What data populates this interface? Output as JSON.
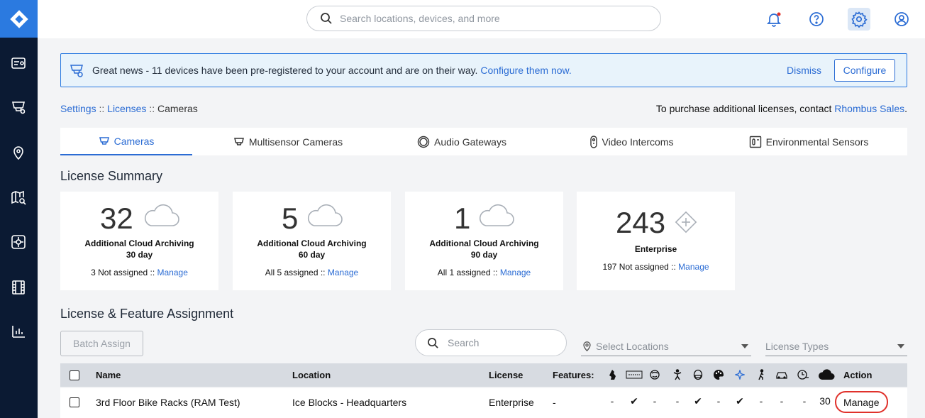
{
  "topbar": {
    "search_placeholder": "Search locations, devices, and more"
  },
  "banner": {
    "message": "Great news - 11 devices have been pre-registered to your account and are on their way. ",
    "link": "Configure them now.",
    "dismiss": "Dismiss",
    "configure": "Configure"
  },
  "breadcrumb": {
    "settings": "Settings",
    "sep1": " :: ",
    "licenses": "Licenses",
    "sep2": " :: ",
    "current": "Cameras"
  },
  "purchase": {
    "text": "To purchase additional licenses, contact ",
    "link": "Rhombus Sales",
    "end": "."
  },
  "tabs": [
    {
      "label": "Cameras"
    },
    {
      "label": "Multisensor Cameras"
    },
    {
      "label": "Audio Gateways"
    },
    {
      "label": "Video Intercoms"
    },
    {
      "label": "Environmental Sensors"
    }
  ],
  "summary": {
    "title": "License Summary",
    "cards": [
      {
        "count": "32",
        "line1": "Additional Cloud Archiving",
        "line2": "30 day",
        "status": "3 Not assigned :: ",
        "manage": "Manage"
      },
      {
        "count": "5",
        "line1": "Additional Cloud Archiving",
        "line2": "60 day",
        "status": "All 5 assigned :: ",
        "manage": "Manage"
      },
      {
        "count": "1",
        "line1": "Additional Cloud Archiving",
        "line2": "90 day",
        "status": "All 1 assigned :: ",
        "manage": "Manage"
      },
      {
        "count": "243",
        "line1": "Enterprise",
        "status": "197 Not assigned :: ",
        "manage": "Manage"
      }
    ]
  },
  "assignment": {
    "title": "License & Feature Assignment",
    "batch_assign": "Batch Assign",
    "search_placeholder": "Search",
    "locations_placeholder": "Select Locations",
    "license_types_placeholder": "License Types"
  },
  "table": {
    "headers": {
      "name": "Name",
      "location": "Location",
      "license": "License",
      "features": "Features:",
      "action": "Action"
    },
    "rows": [
      {
        "name": "3rd Floor Bike Racks (RAM Test)",
        "location": "Ice Blocks - Headquarters",
        "license": "Enterprise",
        "features_dash": "-",
        "feature_values": [
          "-",
          "✔",
          "-",
          "-",
          "✔",
          "-",
          "✔",
          "-",
          "-",
          "-",
          "30"
        ],
        "action": "Manage"
      }
    ]
  },
  "colors": {
    "accent": "#2b6cd4",
    "sidebar": "#0b1a33",
    "logo": "#2b7ae0",
    "highlight_ring": "#e0312b"
  }
}
